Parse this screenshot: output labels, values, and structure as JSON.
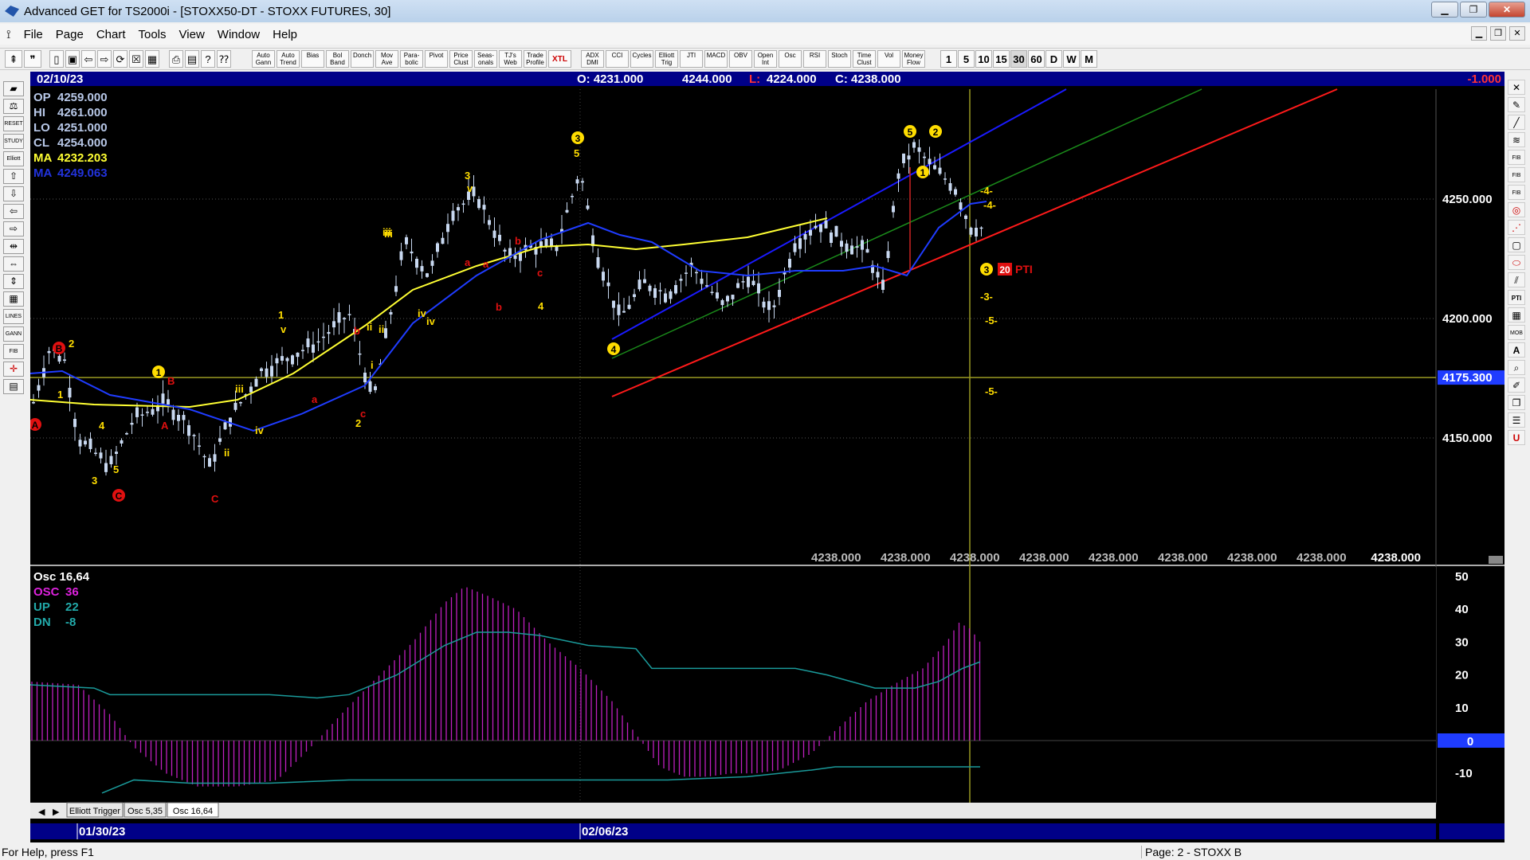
{
  "window": {
    "title": "Advanced GET for TS2000i - [STOXX50-DT - STOXX FUTURES, 30]",
    "min": "▁",
    "max": "❐",
    "close": "✕"
  },
  "menu": [
    "File",
    "Page",
    "Chart",
    "Tools",
    "View",
    "Window",
    "Help"
  ],
  "toolbar": {
    "studies": [
      "Auto\nGann",
      "Auto\nTrend",
      "Bias",
      "Bol\nBand",
      "Donch",
      "Mov\nAve",
      "Para-\nbolic",
      "Pivot",
      "Price\nClust",
      "Seas-\nonals",
      "TJ's\nWeb",
      "Trade\nProfile",
      "XTL",
      "ADX\nDMI",
      "CCI",
      "Cycles",
      "Elliott\nTrig",
      "JTI",
      "MACD",
      "OBV",
      "Open\nInt",
      "Osc",
      "RSI",
      "Stoch",
      "Time\nClust",
      "Vol",
      "Money\nFlow"
    ],
    "periods": [
      "1",
      "5",
      "10",
      "15",
      "30",
      "60",
      "D",
      "W",
      "M"
    ],
    "active_period": "30"
  },
  "header": {
    "date": "02/10/23",
    "open": "O: 4231.000",
    "high": "4244.000",
    "low_label": "L:",
    "low": "4224.000",
    "close": "C: 4238.000",
    "change": "-1.000"
  },
  "info": [
    {
      "label": "OP",
      "value": "4259.000",
      "color": "#b8c8e8"
    },
    {
      "label": "HI",
      "value": "4261.000",
      "color": "#b8c8e8"
    },
    {
      "label": "LO",
      "value": "4251.000",
      "color": "#b8c8e8"
    },
    {
      "label": "CL",
      "value": "4254.000",
      "color": "#b8c8e8"
    },
    {
      "label": "MA",
      "value": "4232.203",
      "color": "#ffff33"
    },
    {
      "label": "MA",
      "value": "4249.063",
      "color": "#2233dd"
    }
  ],
  "price_axis": [
    "4250.000",
    "4200.000",
    "4150.000"
  ],
  "price_marker": "4175.300",
  "projection_labels": [
    "4238.000",
    "4238.000",
    "4238.000",
    "4238.000",
    "4238.000",
    "4238.000",
    "4238.000",
    "4238.000"
  ],
  "last_price": "4238.000",
  "pti": {
    "value": "20",
    "label": "PTI"
  },
  "projection_marks": [
    "-4-",
    "-4-",
    "-3-",
    "-5-",
    "-5-"
  ],
  "wave_labels": {
    "red": [
      "A",
      "B",
      "C",
      "B",
      "A",
      "C",
      "b",
      "a",
      "b",
      "c",
      "a",
      "b",
      "c",
      "a"
    ],
    "yellow": [
      "1",
      "2",
      "3",
      "4",
      "5",
      "1",
      "1",
      "v",
      "i",
      "ii",
      "iii",
      "iv",
      "2",
      "iii",
      "ii",
      "iv",
      "3",
      "v",
      "iii",
      "iv",
      "ii",
      "3",
      "5",
      "4",
      "1",
      "2",
      "3",
      "4",
      "5"
    ]
  },
  "osc": {
    "title": "Osc 16,64",
    "lines": [
      {
        "label": "OSC",
        "value": "36",
        "color": "#dd22dd"
      },
      {
        "label": "UP",
        "value": "22",
        "color": "#22aaaa"
      },
      {
        "label": "DN",
        "value": "-8",
        "color": "#22aaaa"
      }
    ],
    "axis": [
      "40",
      "30",
      "20",
      "10",
      "-10"
    ],
    "top_tick": "50",
    "zero_marker": "0",
    "tabs": [
      "Elliott Trigger",
      "Osc 5,35",
      "Osc 16,64"
    ],
    "active_tab": "Osc 16,64",
    "prev": "◀",
    "next": "▶"
  },
  "time_axis": [
    "01/30/23",
    "02/06/23"
  ],
  "status": {
    "left": "For Help, press F1",
    "right": "Page: 2 - STOXX B"
  }
}
